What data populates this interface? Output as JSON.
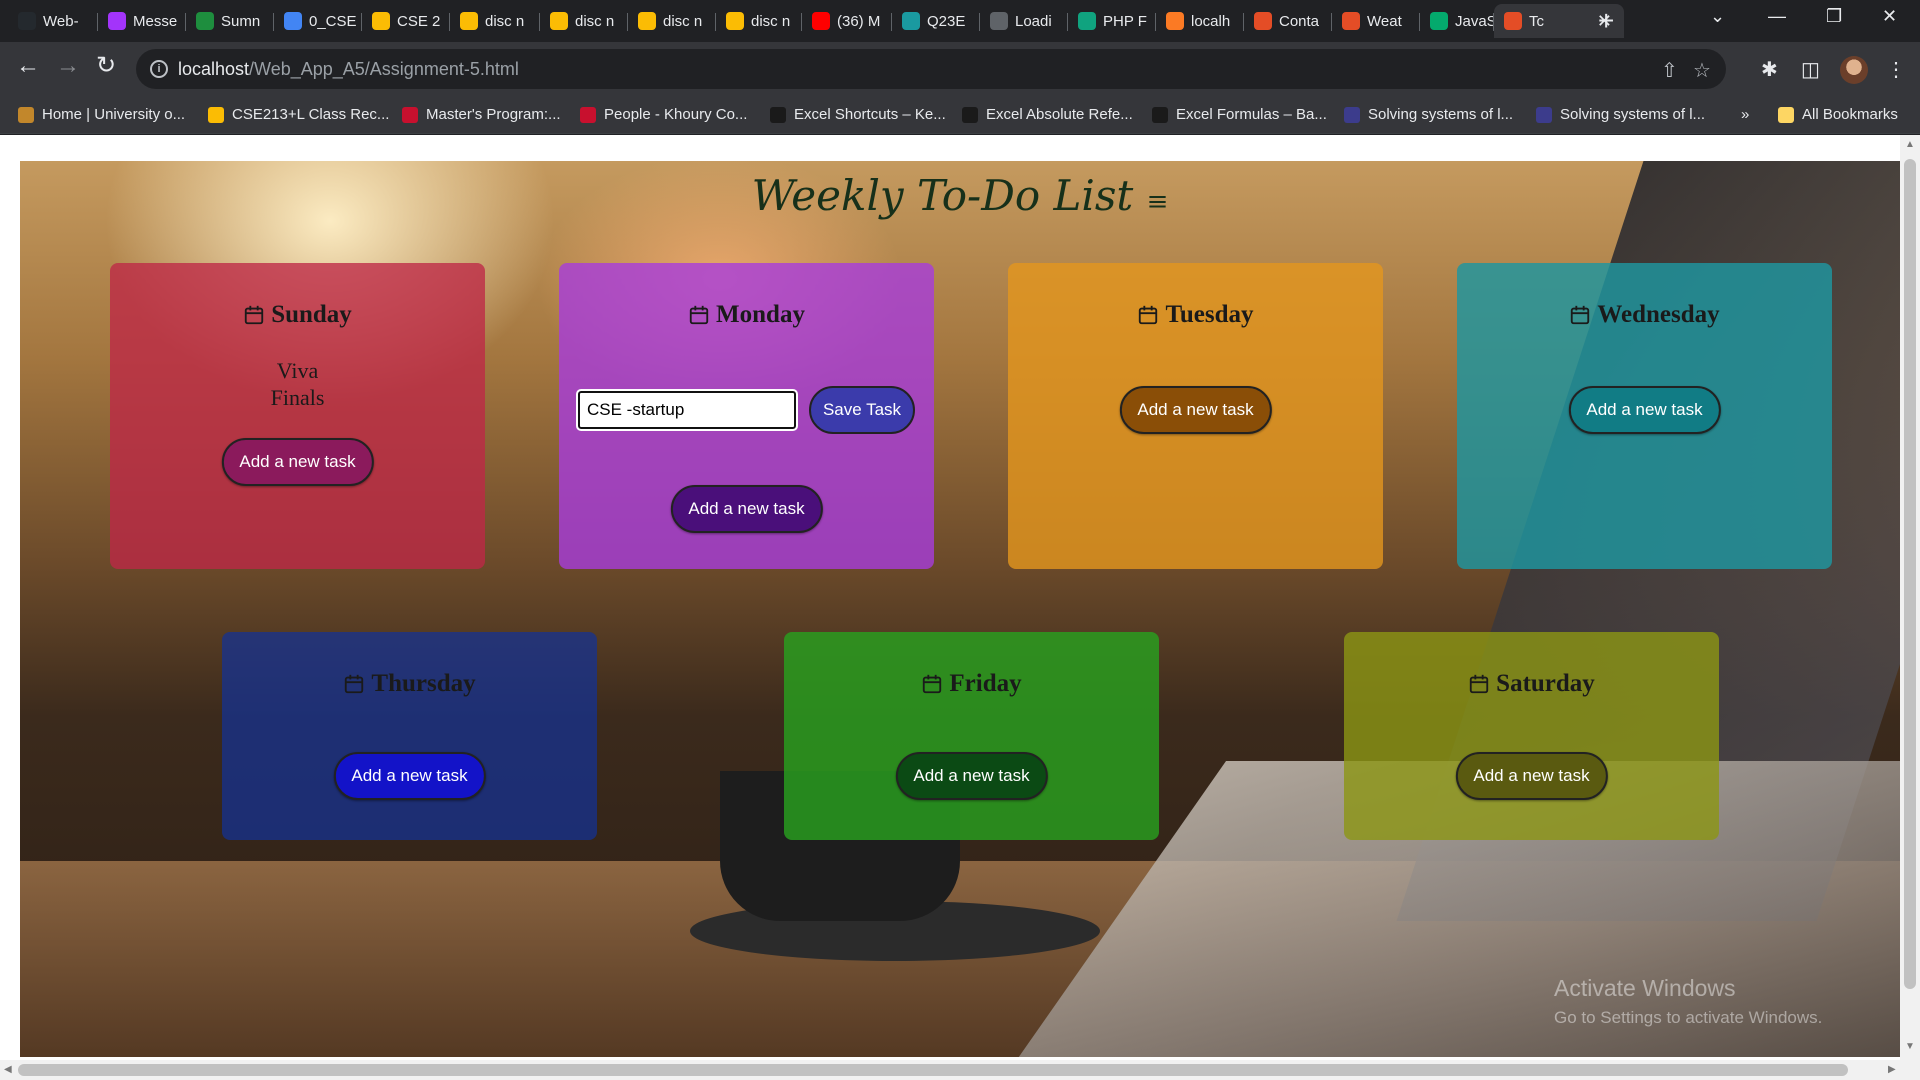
{
  "browser": {
    "tabs": [
      {
        "label": "Web-",
        "icon": "github-icon",
        "color": "#24292e"
      },
      {
        "label": "Messe",
        "icon": "messenger-icon",
        "color": "#a334fa"
      },
      {
        "label": "Sumn",
        "icon": "classroom-icon",
        "color": "#1e8e3e"
      },
      {
        "label": "0_CSE",
        "icon": "docs-icon",
        "color": "#4285f4"
      },
      {
        "label": "CSE 2",
        "icon": "drive-icon",
        "color": "#fbbc04"
      },
      {
        "label": "disc n",
        "icon": "drive-icon",
        "color": "#fbbc04"
      },
      {
        "label": "disc n",
        "icon": "drive-icon",
        "color": "#fbbc04"
      },
      {
        "label": "disc n",
        "icon": "drive-icon",
        "color": "#fbbc04"
      },
      {
        "label": "disc n",
        "icon": "drive-icon",
        "color": "#fbbc04"
      },
      {
        "label": "(36) M",
        "icon": "youtube-icon",
        "color": "#ff0000"
      },
      {
        "label": "Q23E",
        "icon": "codepen-icon",
        "color": "#1a9aa0"
      },
      {
        "label": "Loadi",
        "icon": "globe-icon",
        "color": "#5f6368"
      },
      {
        "label": "PHP F",
        "icon": "chatgpt-icon",
        "color": "#10a37f"
      },
      {
        "label": "localh",
        "icon": "xampp-icon",
        "color": "#fb7a24"
      },
      {
        "label": "Conta",
        "icon": "html-icon",
        "color": "#e44d26"
      },
      {
        "label": "Weat",
        "icon": "html-icon",
        "color": "#e44d26"
      },
      {
        "label": "JavaS",
        "icon": "w3schools-icon",
        "color": "#04aa6d"
      },
      {
        "label": "Tc",
        "icon": "html-icon",
        "color": "#e44d26"
      }
    ],
    "url_host": "localhost",
    "url_path": "/Web_App_A5/Assignment-5.html",
    "bookmarks": [
      {
        "label": "Home | University o...",
        "icon": "university-icon",
        "color": "#c2872b"
      },
      {
        "label": "CSE213+L Class Rec...",
        "icon": "drive-icon",
        "color": "#fbbc04"
      },
      {
        "label": "Master's Program:...",
        "icon": "northeastern-icon",
        "color": "#c8102e"
      },
      {
        "label": "People - Khoury Co...",
        "icon": "northeastern-icon",
        "color": "#c8102e"
      },
      {
        "label": "Excel Shortcuts – Ke...",
        "icon": "exceljet-icon",
        "color": "#1a1a1a"
      },
      {
        "label": "Excel Absolute Refe...",
        "icon": "exceljet-icon",
        "color": "#1a1a1a"
      },
      {
        "label": "Excel Formulas – Ba...",
        "icon": "exceljet-icon",
        "color": "#1a1a1a"
      },
      {
        "label": "Solving systems of l...",
        "icon": "khan-icon",
        "color": "#3c3c8c"
      },
      {
        "label": "Solving systems of l...",
        "icon": "khan-icon",
        "color": "#3c3c8c"
      }
    ],
    "more_bookmarks": "»",
    "all_bookmarks": "All Bookmarks"
  },
  "page": {
    "title": "Weekly To-Do List",
    "title_icon": "✅",
    "add_label": "Add a new task",
    "save_label": "Save Task",
    "days": [
      {
        "name": "Sunday",
        "bg": "rgba(190,40,70,0.78)",
        "btn": "#8b1a5c",
        "tasks": [
          "Viva",
          "Finals"
        ]
      },
      {
        "name": "Monday",
        "bg": "rgba(168,60,220,0.8)",
        "btn": "#4a0f7a",
        "input_value": "CSE -startup"
      },
      {
        "name": "Tuesday",
        "bg": "rgba(228,150,30,0.8)",
        "btn": "#8a4e07",
        "tasks": []
      },
      {
        "name": "Wednesday",
        "bg": "rgba(30,150,160,0.82)",
        "btn": "#117c85",
        "tasks": []
      },
      {
        "name": "Thursday",
        "bg": "rgba(20,50,150,0.72)",
        "btn": "#1313c8",
        "tasks": []
      },
      {
        "name": "Friday",
        "bg": "rgba(40,160,30,0.82)",
        "btn": "#0b4a14",
        "tasks": []
      },
      {
        "name": "Saturday",
        "bg": "rgba(140,150,20,0.8)",
        "btn": "#5a5a10",
        "tasks": []
      }
    ]
  },
  "watermark": {
    "line1": "Activate Windows",
    "line2": "Go to Settings to activate Windows."
  }
}
